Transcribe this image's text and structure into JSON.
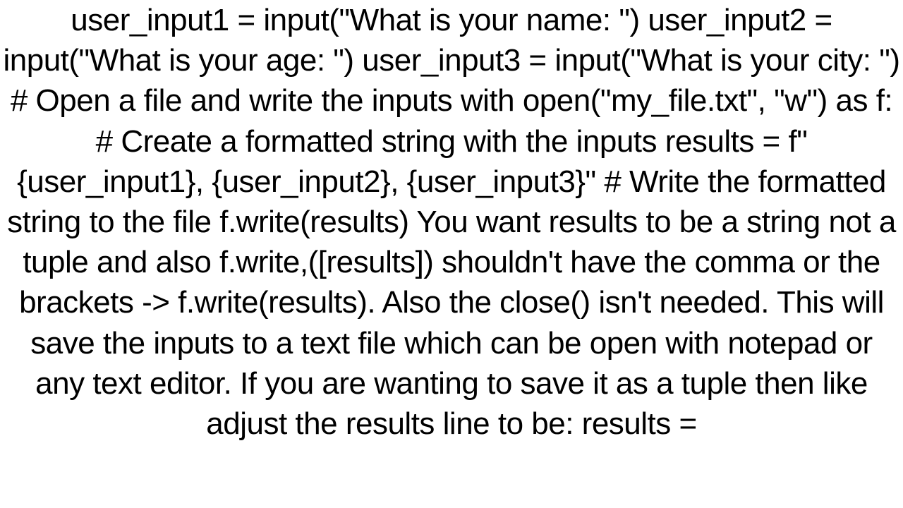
{
  "document": {
    "text": "user_input1 = input(\"What is your name: \") user_input2 = input(\"What is your age: \") user_input3 = input(\"What is your city: \")  # Open a file and write the inputs with open(\"my_file.txt\", \"w\") as f:     # Create a formatted string with the inputs     results = f\"{user_input1}, {user_input2}, {user_input3}\"     # Write the formatted string to the file     f.write(results)  You want results to be a string not a tuple and also f.write,([results]) shouldn't have the comma or the brackets -> f.write(results). Also the close() isn't needed. This will save the inputs to a text file which can be open with notepad or any text editor. If you are wanting to save it as a tuple then like adjust the results line to be: results ="
  }
}
